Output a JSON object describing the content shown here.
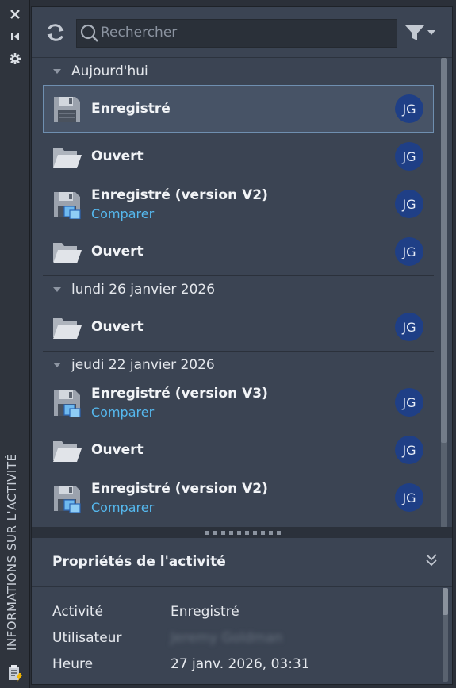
{
  "sidebar": {
    "title": "INFORMATIONS SUR L'ACTIVITÉ",
    "icons": [
      "close-icon",
      "pin-icon",
      "settings-icon",
      "clipboard-icon"
    ]
  },
  "toolbar": {
    "search_placeholder": "Rechercher",
    "refresh_icon": "refresh-icon",
    "filter_icon": "filter-icon"
  },
  "groups": [
    {
      "label": "Aujourd'hui",
      "items": [
        {
          "icon": "save-icon",
          "title": "Enregistré",
          "link": "",
          "user": "JG",
          "selected": true
        },
        {
          "icon": "folder-open-icon",
          "title": "Ouvert",
          "link": "",
          "user": "JG"
        },
        {
          "icon": "save-compare-icon",
          "title": "Enregistré (version V2)",
          "link": "Comparer",
          "user": "JG"
        },
        {
          "icon": "folder-open-icon",
          "title": "Ouvert",
          "link": "",
          "user": "JG"
        }
      ]
    },
    {
      "label": "lundi 26 janvier 2026",
      "items": [
        {
          "icon": "folder-open-icon",
          "title": "Ouvert",
          "link": "",
          "user": "JG"
        }
      ]
    },
    {
      "label": "jeudi 22 janvier 2026",
      "items": [
        {
          "icon": "save-compare-icon",
          "title": "Enregistré (version V3)",
          "link": "Comparer",
          "user": "JG"
        },
        {
          "icon": "folder-open-icon",
          "title": "Ouvert",
          "link": "",
          "user": "JG"
        },
        {
          "icon": "save-compare-icon",
          "title": "Enregistré (version V2)",
          "link": "Comparer",
          "user": "JG"
        }
      ]
    }
  ],
  "properties": {
    "title": "Propriétés de l'activité",
    "rows": [
      {
        "key": "Activité",
        "value": "Enregistré"
      },
      {
        "key": "Utilisateur",
        "value": "Jeremy Goldman",
        "blurred": true
      },
      {
        "key": "Heure",
        "value": "27 janv. 2026, 03:31"
      }
    ]
  },
  "colors": {
    "panel_bg": "#3b4453",
    "selection_border": "#6f8fb0",
    "link": "#55b8ee",
    "avatar_bg": "#1f3f86"
  }
}
